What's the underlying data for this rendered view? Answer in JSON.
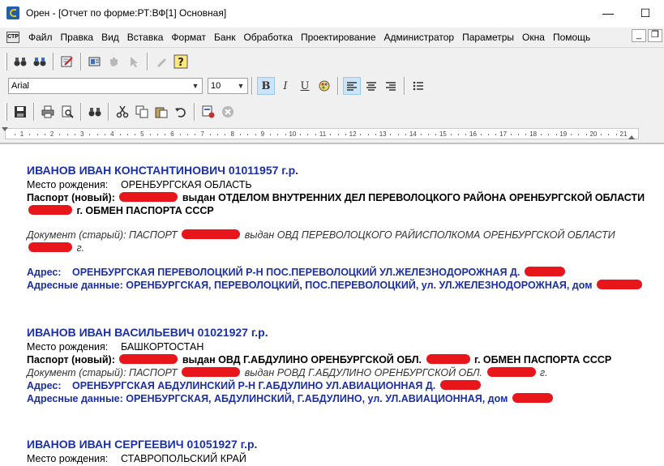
{
  "window": {
    "title": "Орен - [Отчет по форме:РТ:ВФ[1] Основная]",
    "minimize": "—",
    "maximize": "☐"
  },
  "menu": {
    "mdi_icon": "СТР",
    "items": [
      "Файл",
      "Правка",
      "Вид",
      "Вставка",
      "Формат",
      "Банк",
      "Обработка",
      "Проектирование",
      "Администратор",
      "Параметры",
      "Окна",
      "Помощь"
    ],
    "mdi_min": "_",
    "mdi_restore": "❐"
  },
  "format_toolbar": {
    "font": "Arial",
    "size": "10"
  },
  "ruler": {
    "numbers": [
      "1",
      "2",
      "3",
      "4",
      "5",
      "6",
      "7",
      "8",
      "9",
      "10",
      "11",
      "12",
      "13",
      "14",
      "15",
      "16",
      "17",
      "18",
      "19",
      "20",
      "21"
    ]
  },
  "records": [
    {
      "name": "ИВАНОВ ИВАН КОНСТАНТИНОВИЧ 01011957 г.р.",
      "birthplace_label": "Место рождения:",
      "birthplace": "ОРЕНБУРГСКАЯ ОБЛАСТЬ",
      "passport_label": "Паспорт (новый):",
      "passport_issued": "выдан ОТДЕЛОМ ВНУТРЕННИХ ДЕЛ ПЕРЕВОЛОЦКОГО РАЙОНА ОРЕНБУРГСКОЙ ОБЛАСТИ",
      "passport_tail": "г. ОБМЕН ПАСПОРТА СССР",
      "doc_label": "Документ (старый): ПАСПОРТ",
      "doc_issued": "выдан ОВД ПЕРЕВОЛОЦКОГО РАЙИСПОЛКОМА  ОРЕНБУРГСКОЙ ОБЛАСТИ",
      "doc_tail": "г.",
      "address_label": "Адрес:",
      "address": "ОРЕНБУРГСКАЯ ПЕРЕВОЛОЦКИЙ Р-Н ПОС.ПЕРЕВОЛОЦКИЙ УЛ.ЖЕЛЕЗНОДОРОЖНАЯ Д.",
      "addrdata_label": "Адресные данные:",
      "addrdata": "ОРЕНБУРГСКАЯ, ПЕРЕВОЛОЦКИЙ, ПОС.ПЕРЕВОЛОЦКИЙ, ул. УЛ.ЖЕЛЕЗНОДОРОЖНАЯ, дом"
    },
    {
      "name": "ИВАНОВ ИВАН ВАСИЛЬЕВИЧ 01021927 г.р.",
      "birthplace_label": "Место рождения:",
      "birthplace": "БАШКОРТОСТАН",
      "passport_label": "Паспорт (новый):",
      "passport_issued": "выдан ОВД Г.АБДУЛИНО ОРЕНБУРГСКОЙ ОБЛ.",
      "passport_tail": "г. ОБМЕН ПАСПОРТА СССР",
      "doc_label": "Документ (старый): ПАСПОРТ",
      "doc_issued": "выдан РОВД Г.АБДУЛИНО ОРЕНБУРГСКОЙ ОБЛ.",
      "doc_tail": "г.",
      "address_label": "Адрес:",
      "address": "ОРЕНБУРГСКАЯ АБДУЛИНСКИЙ Р-Н Г.АБДУЛИНО УЛ.АВИАЦИОННАЯ Д.",
      "addrdata_label": "Адресные данные:",
      "addrdata": "ОРЕНБУРГСКАЯ, АБДУЛИНСКИЙ, Г.АБДУЛИНО, ул. УЛ.АВИАЦИОННАЯ, дом"
    },
    {
      "name": "ИВАНОВ ИВАН СЕРГЕЕВИЧ 01051927 г.р.",
      "birthplace_label": "Место рождения:",
      "birthplace": "СТАВРОПОЛЬСКИЙ КРАЙ"
    }
  ]
}
